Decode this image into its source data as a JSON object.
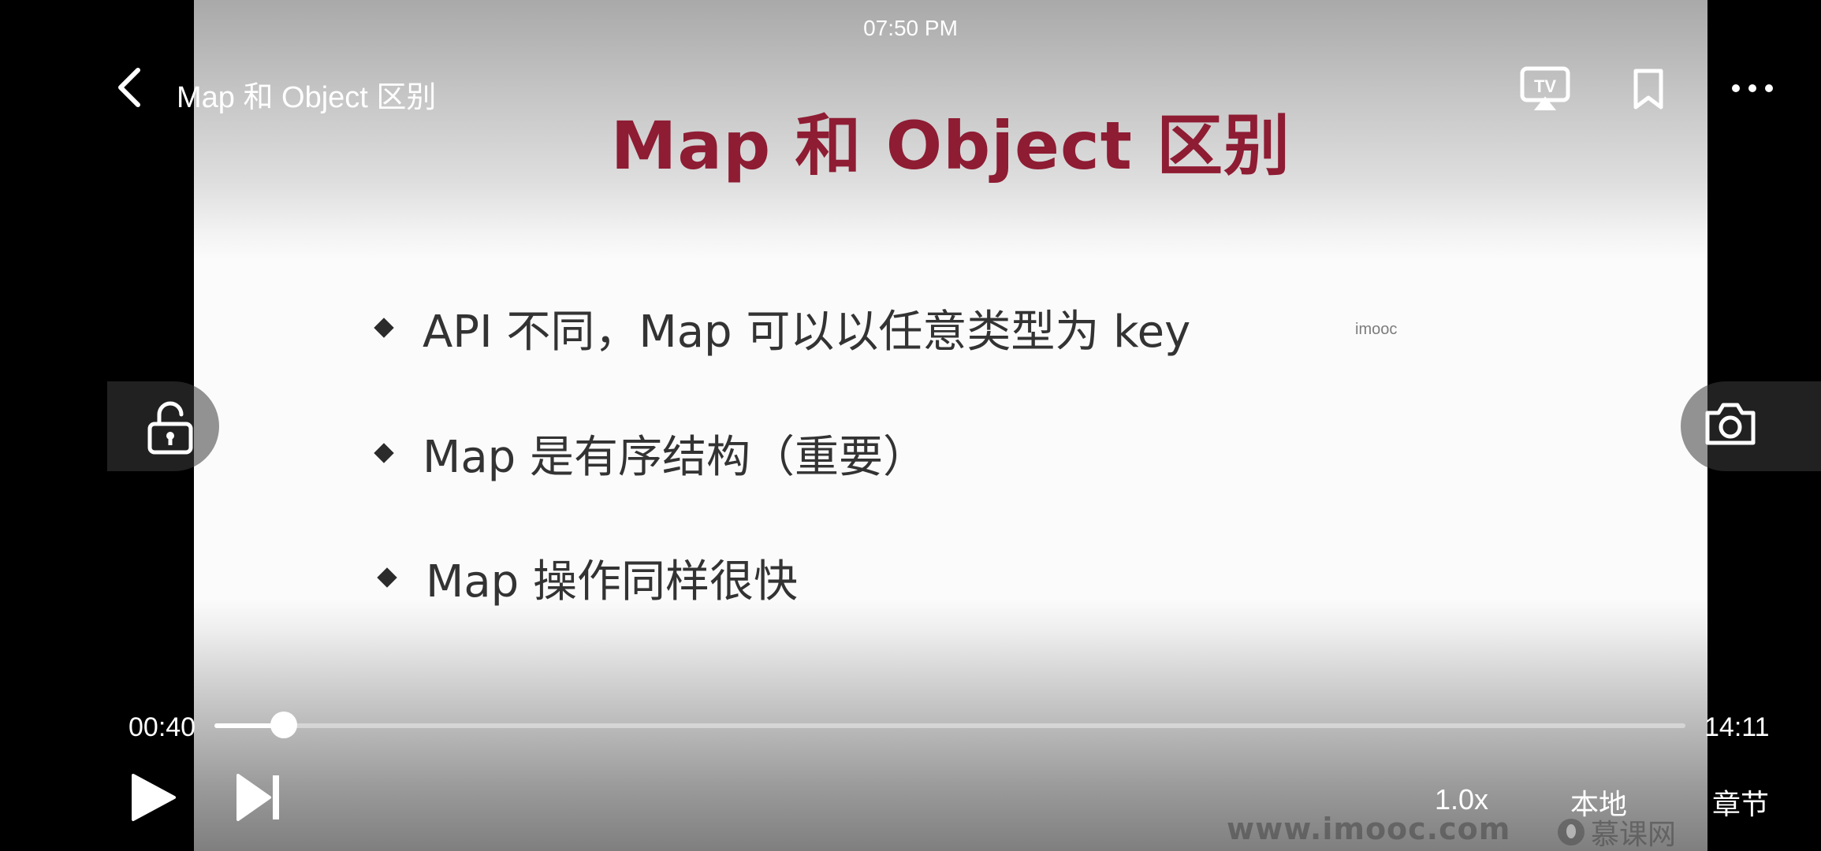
{
  "status_bar": {
    "time": "07:50 PM"
  },
  "header": {
    "title": "Map 和 Object 区别",
    "back_icon": "chevron-left-icon",
    "cast_icon": "tv-cast-icon",
    "bookmark_icon": "bookmark-icon",
    "more_icon": "more-dots-icon"
  },
  "slide": {
    "title": "Map 和 Object 区别",
    "bullets": [
      "API 不同，Map 可以以任意类型为 key",
      "Map 是有序结构（重要）",
      "Map 操作同样很快"
    ],
    "watermark_small": "imooc",
    "watermark_url": "www.imooc.com",
    "watermark_brand": "慕课网"
  },
  "side_controls": {
    "lock_icon": "unlock-icon",
    "camera_icon": "camera-icon"
  },
  "player": {
    "current_time": "00:40",
    "total_time": "14:11",
    "progress": 0.047,
    "speed_label": "1.0x",
    "local_label": "本地",
    "chapters_label": "章节",
    "play_icon": "play-icon",
    "next_icon": "skip-next-icon"
  },
  "colors": {
    "slide_title": "#8e1c33",
    "bullet_text": "#333333",
    "overlay_text": "#ffffff"
  }
}
